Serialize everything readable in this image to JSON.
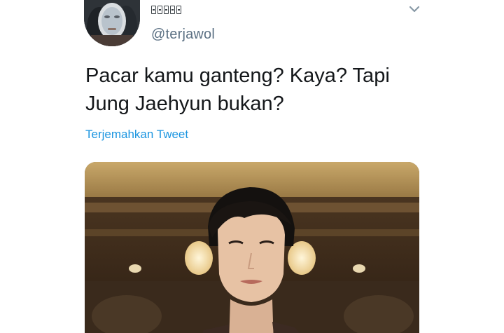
{
  "tweet": {
    "author": {
      "display_name_glyph_count": 5,
      "handle": "@terjawol",
      "avatar_icon": "avatar-face-mask-icon"
    },
    "menu_icon": "chevron-down-icon",
    "text_line_1": "Pacar kamu ganteng? Kaya? Tapi",
    "text_line_2": "Jung Jaehyun bukan?",
    "translate_label": "Terjemahkan Tweet",
    "media": {
      "type": "photo",
      "icon": "photo-portrait-icon"
    }
  },
  "colors": {
    "handle": "#5b7083",
    "link": "#1b95e0",
    "text": "#14171a",
    "caret": "#8899a6"
  }
}
